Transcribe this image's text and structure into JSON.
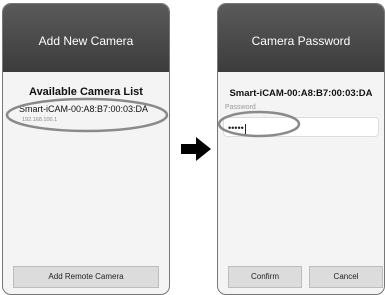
{
  "add_camera": {
    "title": "Add New Camera",
    "list_title": "Available Camera List",
    "camera": {
      "name": "Smart-iCAM-00:A8:B7:00:03:DA",
      "ip": "192.168.100.1"
    },
    "add_remote_label": "Add Remote Camera"
  },
  "camera_password": {
    "title": "Camera Password",
    "camera_name": "Smart-iCAM-00:A8:B7:00:03:DA",
    "password_label": "Password",
    "password_value": "•••••",
    "confirm_label": "Confirm",
    "cancel_label": "Cancel"
  },
  "icons": {
    "transition": "right-arrow-icon"
  },
  "colors": {
    "titlebar": "#4a4a4a",
    "highlight_ring": "#8a8a8a",
    "button": "#dcdcdc"
  }
}
